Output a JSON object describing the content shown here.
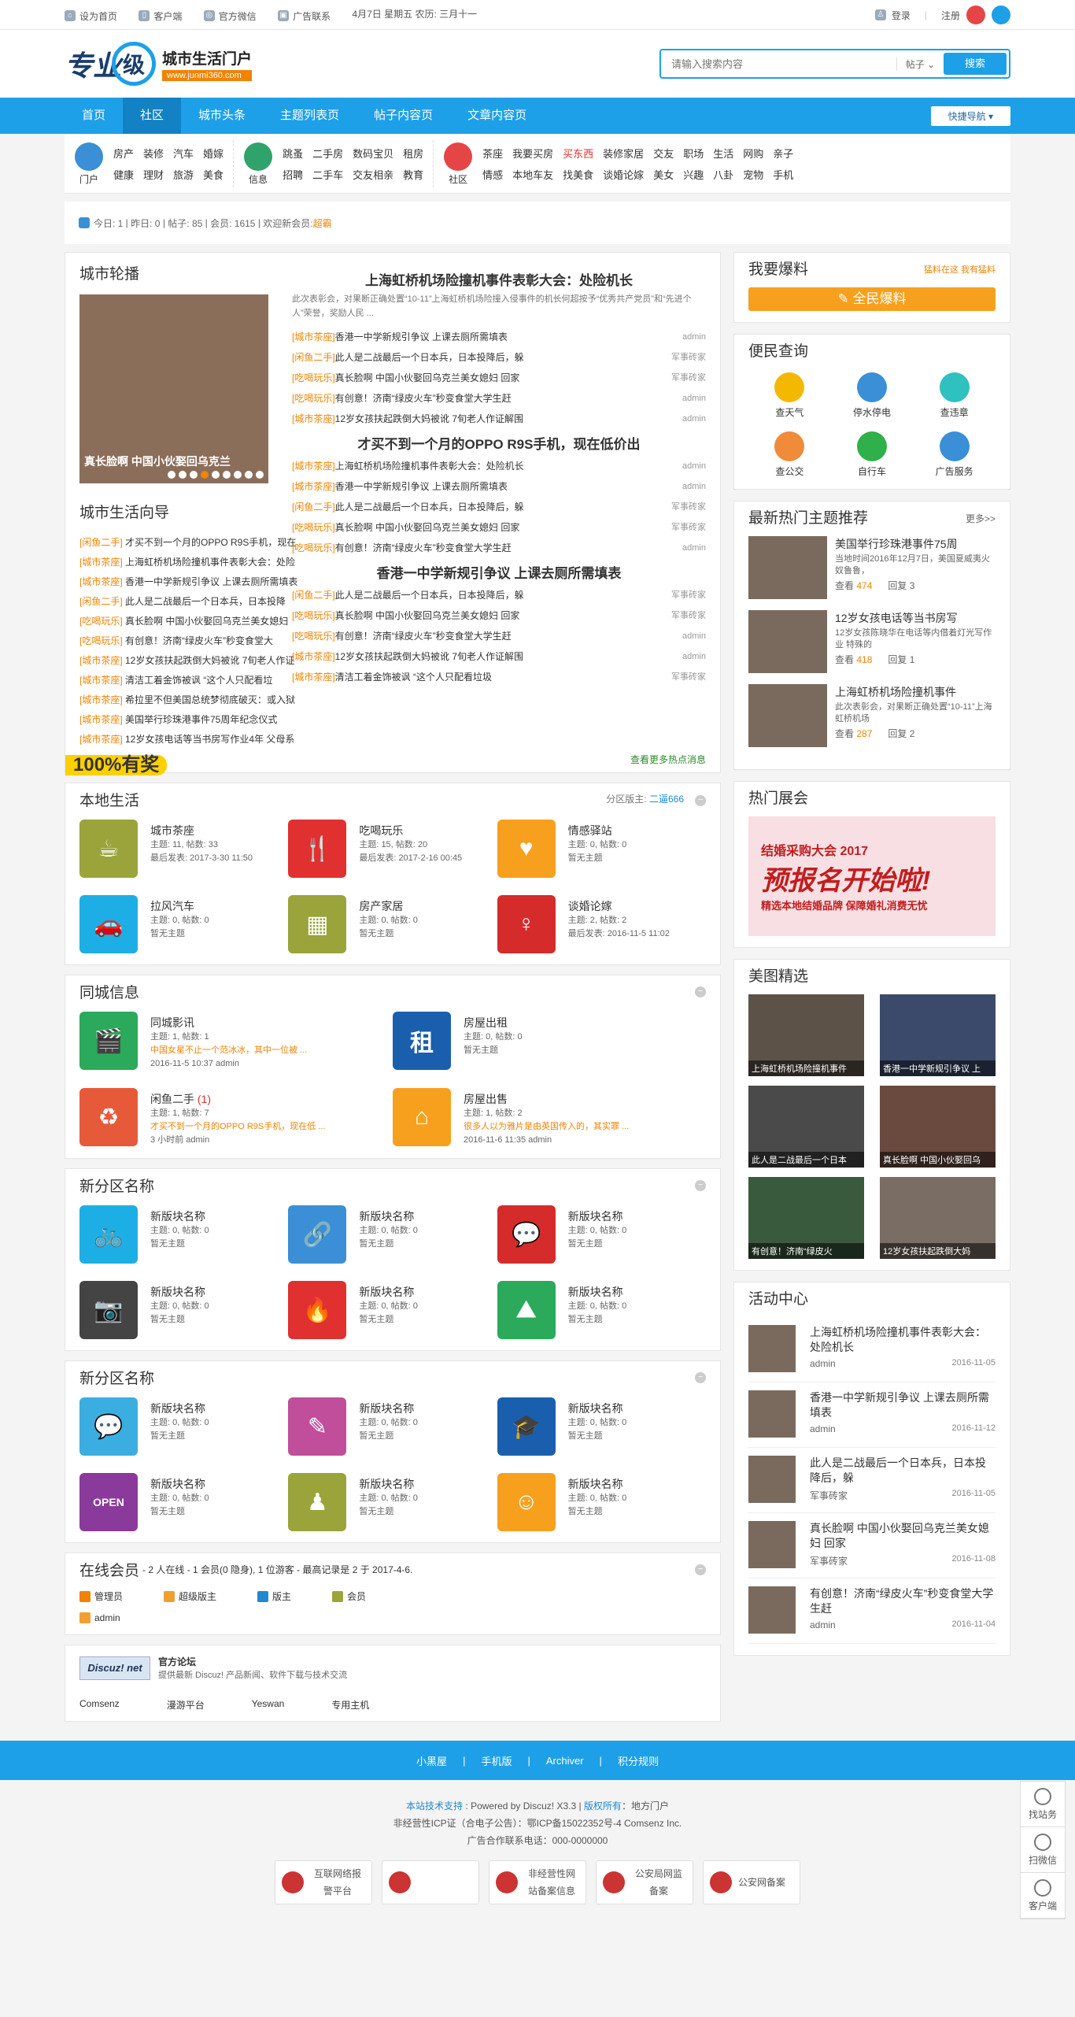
{
  "topbar": {
    "set_home": "设为首页",
    "client": "客户端",
    "wechat": "官方微信",
    "ad": "广告联系",
    "date": "4月7日  星期五  农历: 三月十一",
    "login": "登录",
    "register": "注册"
  },
  "logo": {
    "main": "专业",
    "circle": "级",
    "title": "城市生活门户",
    "url": "www.junmi360.com"
  },
  "search": {
    "placeholder": "请输入搜索内容",
    "type": "帖子",
    "button": "搜索"
  },
  "nav": {
    "items": [
      "首页",
      "社区",
      "城市头条",
      "主题列表页",
      "帖子内容页",
      "文章内容页"
    ],
    "active": 1,
    "quick": "快捷导航 ▾"
  },
  "cats": [
    {
      "label": "门户",
      "links": [
        "房产",
        "装修",
        "汽车",
        "婚嫁",
        "健康",
        "理财",
        "旅游",
        "美食"
      ],
      "color": "#3a8fd6"
    },
    {
      "label": "信息",
      "links": [
        "跳蚤",
        "二手房",
        "数码宝贝",
        "租房",
        "招聘",
        "二手车",
        "交友相亲",
        "教育"
      ],
      "color": "#2fa36b"
    },
    {
      "label": "社区",
      "links": [
        "茶座",
        "我要买房",
        "买东西",
        "装修家居",
        "交友",
        "职场",
        "生活",
        "网购",
        "亲子",
        "情感",
        "本地车友",
        "找美食",
        "谈婚论嫁",
        "美女",
        "兴趣",
        "八卦",
        "宠物",
        "手机"
      ],
      "color": "#e64545"
    }
  ],
  "stats": {
    "today": "今日: 1",
    "yesterday": "昨日: 0",
    "posts": "帖子: 85",
    "members": "会员: 1615",
    "welcome": "欢迎新会员: ",
    "newuser": "超霸"
  },
  "hot": {
    "carousel_title": "城市轮播",
    "slide_caption": "真长脸啊  中国小伙娶回乌克兰",
    "guide_title": "城市生活向导",
    "guide": [
      [
        "[闲鱼二手]",
        "才买不到一个月的OPPO R9S手机，现在"
      ],
      [
        "[城市茶座]",
        "上海虹桥机场险撞机事件表彰大会：处险"
      ],
      [
        "[城市茶座]",
        "香港一中学新规引争议 上课去厕所需填表"
      ],
      [
        "[闲鱼二手]",
        "此人是二战最后一个日本兵，日本投降"
      ],
      [
        "[吃喝玩乐]",
        "真长脸啊 中国小伙娶回乌克兰美女媳妇"
      ],
      [
        "[吃喝玩乐]",
        "有创意！济南“绿皮火车”秒变食堂大"
      ],
      [
        "[城市茶座]",
        "12岁女孩扶起跌倒大妈被讹 7旬老人作证"
      ],
      [
        "[城市茶座]",
        "清洁工着金饰被讽  “这个人只配看垃"
      ],
      [
        "[城市茶座]",
        "希拉里不但美国总统梦彻底破灭：或入狱"
      ],
      [
        "[城市茶座]",
        "美国举行珍珠港事件75周年纪念仪式"
      ],
      [
        "[城市茶座]",
        "12岁女孩电话等当书房写作业4年 父母系"
      ]
    ],
    "h1": "上海虹桥机场险撞机事件表彰大会：处险机长",
    "summary": "此次表彰会，对果断正确处置“10-11”上海虹桥机场险撞入侵事件的机长何超按予“优秀共产党员”和“先进个人”荣誉，奖励人民 ...",
    "list1": [
      [
        "[城市茶座]",
        "香港一中学新规引争议 上课去厕所需填表",
        "admin"
      ],
      [
        "[闲鱼二手]",
        "此人是二战最后一个日本兵，日本投降后，躲",
        "军事砖家"
      ],
      [
        "[吃喝玩乐]",
        "真长脸啊 中国小伙娶回乌克兰美女媳妇 回家",
        "军事砖家"
      ],
      [
        "[吃喝玩乐]",
        "有创意！济南“绿皮火车”秒变食堂大学生赶",
        "admin"
      ],
      [
        "[城市茶座]",
        "12岁女孩扶起跌倒大妈被讹 7旬老人作证解围",
        "admin"
      ]
    ],
    "h2": "才买不到一个月的OPPO R9S手机，现在低价出",
    "list2": [
      [
        "[城市茶座]",
        "上海虹桥机场险撞机事件表彰大会：处险机长",
        "admin"
      ],
      [
        "[城市茶座]",
        "香港一中学新规引争议 上课去厕所需填表",
        "admin"
      ],
      [
        "[闲鱼二手]",
        "此人是二战最后一个日本兵，日本投降后，躲",
        "军事砖家"
      ],
      [
        "[吃喝玩乐]",
        "真长脸啊 中国小伙娶回乌克兰美女媳妇 回家",
        "军事砖家"
      ],
      [
        "[吃喝玩乐]",
        "有创意！济南“绿皮火车”秒变食堂大学生赶",
        "admin"
      ]
    ],
    "h3": "香港一中学新规引争议 上课去厕所需填表",
    "list3": [
      [
        "[闲鱼二手]",
        "此人是二战最后一个日本兵，日本投降后，躲",
        "军事砖家"
      ],
      [
        "[吃喝玩乐]",
        "真长脸啊 中国小伙娶回乌克兰美女媳妇 回家",
        "军事砖家"
      ],
      [
        "[吃喝玩乐]",
        "有创意！济南“绿皮火车”秒变食堂大学生赶",
        "admin"
      ],
      [
        "[城市茶座]",
        "12岁女孩扶起跌倒大妈被讹 7旬老人作证解围",
        "admin"
      ],
      [
        "[城市茶座]",
        "清洁工着金饰被讽  “这个人只配看垃圾",
        "军事砖家"
      ]
    ],
    "banner": "100%有奖",
    "more": "查看更多热点消息"
  },
  "local": {
    "title": "本地生活",
    "mod_label": "分区版主: ",
    "mod": "二逼666",
    "forums": [
      {
        "name": "城市茶座",
        "s": "主题: 11, 帖数: 33",
        "l": "最后发表: 2017-3-30 11:50",
        "color": "#9aa43a",
        "icon": "☕"
      },
      {
        "name": "吃喝玩乐",
        "s": "主题: 15, 帖数: 20",
        "l": "最后发表: 2017-2-16 00:45",
        "color": "#e03030",
        "icon": "🍴"
      },
      {
        "name": "情感驿站",
        "s": "主题: 0, 帖数: 0",
        "l": "暂无主题",
        "color": "#f7a01e",
        "icon": "♥"
      },
      {
        "name": "拉风汽车",
        "s": "主题: 0, 帖数: 0",
        "l": "暂无主题",
        "color": "#1eaee6",
        "icon": "🚗"
      },
      {
        "name": "房产家居",
        "s": "主题: 0, 帖数: 0",
        "l": "暂无主题",
        "color": "#9aa43a",
        "icon": "▦"
      },
      {
        "name": "谈婚论嫁",
        "s": "主题: 2, 帖数: 2",
        "l": "最后发表: 2016-11-5 11:02",
        "color": "#d52b2b",
        "icon": "♀"
      }
    ]
  },
  "city": {
    "title": "同城信息",
    "forums": [
      {
        "name": "同城影讯",
        "s": "主题: 1, 帖数: 1",
        "o": "中国女星不止一个范冰冰，其中一位被 ...",
        "l": "2016-11-5 10:37 admin",
        "color": "#2aaa5a",
        "icon": "🎬"
      },
      {
        "name": "房屋出租",
        "s": "主题: 0, 帖数: 0",
        "o": "",
        "l": "暂无主题",
        "color": "#1a5fae",
        "icon": "租"
      },
      {
        "name": "闲鱼二手",
        "count": "(1)",
        "s": "主题: 1, 帖数: 7",
        "o": "才买不到一个月的OPPO R9S手机，现在低 ...",
        "l": "3 小时前 admin",
        "color": "#e65a3a",
        "icon": "♻"
      },
      {
        "name": "房屋出售",
        "s": "主题: 1, 帖数: 2",
        "o": "很多人以为雅片是由英国传入的，其实罪 ...",
        "l": "2016-11-6 11:35 admin",
        "color": "#f7a01e",
        "icon": "⌂"
      }
    ]
  },
  "new1": {
    "title": "新分区名称",
    "forums": [
      {
        "name": "新版块名称",
        "s": "主题: 0, 帖数: 0",
        "l": "暂无主题",
        "color": "#1eaee6",
        "icon": "🚲"
      },
      {
        "name": "新版块名称",
        "s": "主题: 0, 帖数: 0",
        "l": "暂无主题",
        "color": "#3a8fd6",
        "icon": "🔗"
      },
      {
        "name": "新版块名称",
        "s": "主题: 0, 帖数: 0",
        "l": "暂无主题",
        "color": "#d52b2b",
        "icon": "💬"
      },
      {
        "name": "新版块名称",
        "s": "主题: 0, 帖数: 0",
        "l": "暂无主题",
        "color": "#444",
        "icon": "📷"
      },
      {
        "name": "新版块名称",
        "s": "主题: 0, 帖数: 0",
        "l": "暂无主题",
        "color": "#e03030",
        "icon": "🔥"
      },
      {
        "name": "新版块名称",
        "s": "主题: 0, 帖数: 0",
        "l": "暂无主题",
        "color": "#2aaa5a",
        "icon": "⛰"
      }
    ]
  },
  "new2": {
    "title": "新分区名称",
    "forums": [
      {
        "name": "新版块名称",
        "s": "主题: 0, 帖数: 0",
        "l": "暂无主题",
        "color": "#3aaee0",
        "icon": "💬"
      },
      {
        "name": "新版块名称",
        "s": "主题: 0, 帖数: 0",
        "l": "暂无主题",
        "color": "#c04e9a",
        "icon": "✎"
      },
      {
        "name": "新版块名称",
        "s": "主题: 0, 帖数: 0",
        "l": "暂无主题",
        "color": "#1a5fae",
        "icon": "🎓"
      },
      {
        "name": "新版块名称",
        "s": "主题: 0, 帖数: 0",
        "l": "暂无主题",
        "color": "#8a3a9a",
        "icon": "OPEN"
      },
      {
        "name": "新版块名称",
        "s": "主题: 0, 帖数: 0",
        "l": "暂无主题",
        "color": "#9aa43a",
        "icon": "♟"
      },
      {
        "name": "新版块名称",
        "s": "主题: 0, 帖数: 0",
        "l": "暂无主题",
        "color": "#f7a01e",
        "icon": "☺"
      }
    ]
  },
  "online": {
    "title": "在线会员",
    "detail": "- 2 人在线 - 1 会员(0 隐身), 1 位游客 - 最高记录是 2 于 2017-4-6.",
    "legend": [
      "管理员",
      "超级版主",
      "版主",
      "会员"
    ],
    "user": "admin"
  },
  "links": {
    "logo": "Discuz! net",
    "title": "官方论坛",
    "desc": "提供最新 Discuz! 产品新闻、软件下载与技术交流",
    "items": [
      "Comsenz",
      "漫游平台",
      "Yeswan",
      "专用主机"
    ]
  },
  "right": {
    "baoliao": {
      "title": "我要爆料",
      "badge": "猛料在这 我有猛料",
      "button": "全民爆料"
    },
    "bianmin": {
      "title": "便民查询",
      "items": [
        [
          "查天气",
          "#f5b800"
        ],
        [
          "停水停电",
          "#3a8fd6"
        ],
        [
          "查违章",
          "#2fc0c0"
        ],
        [
          "查公交",
          "#f08b3a"
        ],
        [
          "自行车",
          "#2fb04a"
        ],
        [
          "广告服务",
          "#3a8fd6"
        ]
      ]
    },
    "hotth": {
      "title": "最新热门主题推荐",
      "more": "更多>>",
      "items": [
        {
          "t": "美国举行珍珠港事件75周",
          "d": "当地时间2016年12月7日，美国夏威夷火奴鲁鲁，",
          "view": "474",
          "reply": "3"
        },
        {
          "t": "12岁女孩电话等当书房写",
          "d": "12岁女孩陈晓华在电话等内借着灯光写作业 特殊的",
          "view": "418",
          "reply": "1"
        },
        {
          "t": "上海虹桥机场险撞机事件",
          "d": "此次表彰会，对果断正确处置“10-11”上海虹桥机场",
          "view": "287",
          "reply": "2"
        }
      ]
    },
    "expo": {
      "title": "热门展会",
      "a": "结婚采购大会 2017",
      "b": "预报名开始啦!",
      "c": "精选本地结婚品牌 保障婚礼消费无忧"
    },
    "pics": {
      "title": "美图精选",
      "items": [
        "上海虹桥机场险撞机事件",
        "香港一中学新规引争议 上",
        "此人是二战最后一个日本",
        "真长脸啊 中国小伙娶回乌",
        "有创意！济南“绿皮火",
        "12岁女孩扶起跌倒大妈"
      ]
    },
    "acts": {
      "title": "活动中心",
      "items": [
        {
          "t": "上海虹桥机场险撞机事件表彰大会：处险机长",
          "u": "admin",
          "d": "2016-11-05"
        },
        {
          "t": "香港一中学新规引争议 上课去厕所需填表",
          "u": "admin",
          "d": "2016-11-12"
        },
        {
          "t": "此人是二战最后一个日本兵，日本投降后，躲",
          "u": "军事砖家",
          "d": "2016-11-05"
        },
        {
          "t": "真长脸啊 中国小伙娶回乌克兰美女媳妇 回家",
          "u": "军事砖家",
          "d": "2016-11-08"
        },
        {
          "t": "有创意！济南“绿皮火车”秒变食堂大学生赶",
          "u": "admin",
          "d": "2016-11-04"
        }
      ]
    }
  },
  "footer": {
    "nav": [
      "小黑屋",
      "手机版",
      "Archiver",
      "积分规则"
    ],
    "support": "本站技术支持",
    "powered": "Powered by Discuz! X3.3 |",
    "rights": "版权所有",
    "site": "：地方门户",
    "icp": "非经营性ICP证（合电子公告）：鄂ICP备15022352号-4  Comsenz Inc.",
    "adtel": "广告合作联系电话：000-0000000",
    "badges": [
      "互联网络报警平台",
      "",
      "非经营性网站备案信息",
      "公安局网监备案",
      "公安网备案"
    ]
  },
  "tools": [
    "找站务",
    "扫微信",
    "客户端"
  ]
}
